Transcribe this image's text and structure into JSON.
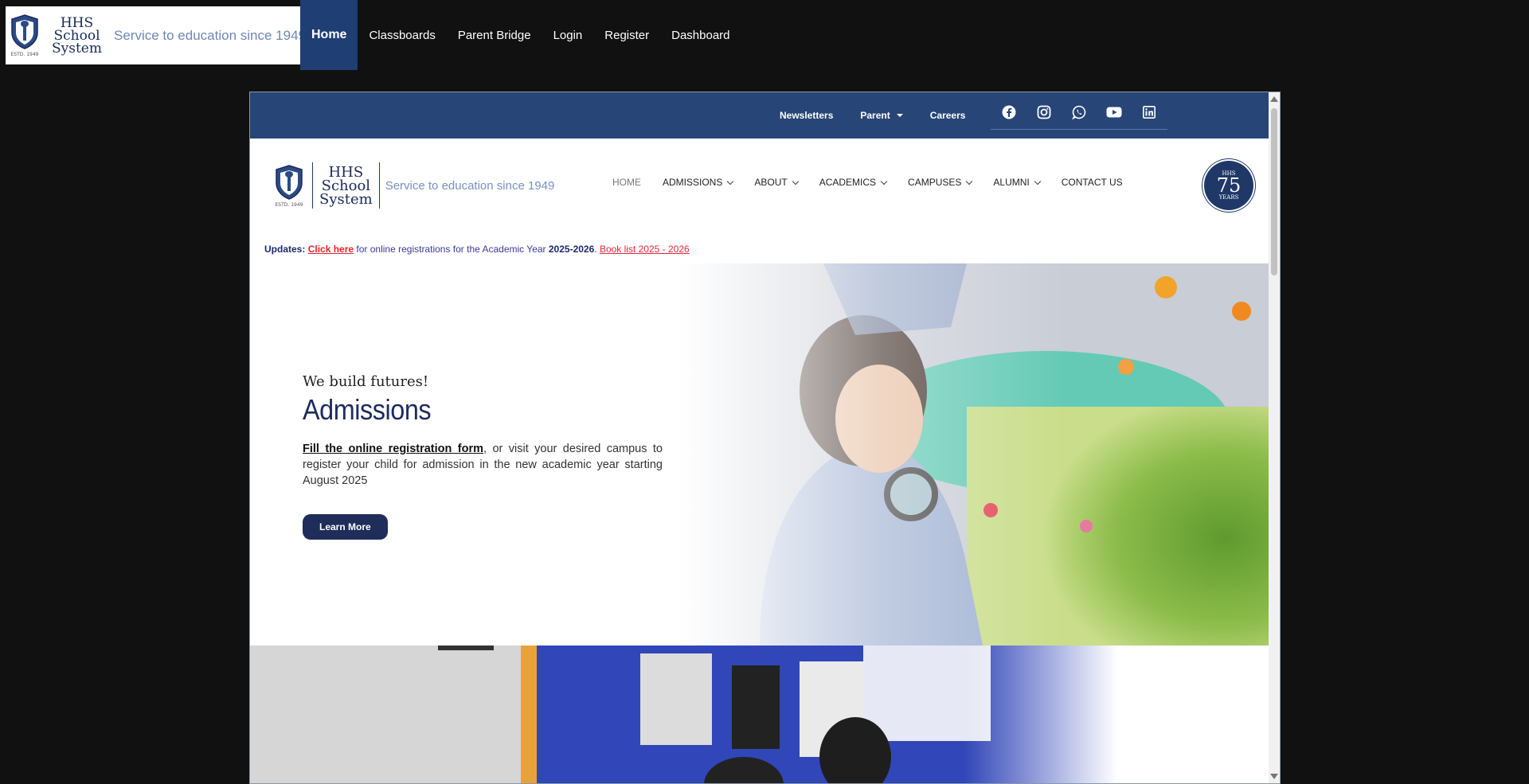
{
  "outer_nav": {
    "logo": {
      "name_lines": [
        "HHS",
        "School",
        "System"
      ],
      "tagline": "Service to education since 1949",
      "estd": "ESTD. 1949"
    },
    "items": [
      {
        "label": "Home",
        "active": true
      },
      {
        "label": "Classboards"
      },
      {
        "label": "Parent Bridge"
      },
      {
        "label": "Login"
      },
      {
        "label": "Register"
      },
      {
        "label": "Dashboard"
      }
    ]
  },
  "site": {
    "topbar": {
      "links": [
        "Newsletters",
        "Parent",
        "Careers"
      ],
      "social_icons": [
        "facebook-icon",
        "instagram-icon",
        "whatsapp-icon",
        "youtube-icon",
        "linkedin-icon"
      ]
    },
    "logo": {
      "name_lines": [
        "HHS",
        "School",
        "System"
      ],
      "tagline": "Service to education since 1949",
      "estd": "ESTD. 1949"
    },
    "main_nav": [
      "HOME",
      "ADMISSIONS",
      "ABOUT",
      "ACADEMICS",
      "CAMPUSES",
      "ALUMNI",
      "CONTACT US"
    ],
    "badge": {
      "top": "HHS",
      "number": "75",
      "bottom": "YEARS"
    },
    "updates": {
      "label": "Updates:",
      "click_here": "Click here",
      "text": " for online registrations for the Academic Year ",
      "year": "2025-2026",
      "dot": ". ",
      "book_list": "Book list 2025 - 2026"
    },
    "hero": {
      "subtitle": "We build futures!",
      "title": "Admissions",
      "form_link": "Fill the online registration form",
      "body": ", or visit your desired campus to register your child for admission in the new academic year starting August 2025",
      "button": "Learn More"
    }
  },
  "colors": {
    "outer_bg": "#111111",
    "nav_active": "#1f3e73",
    "topbar": "#274577",
    "navy_text": "#1d2b5e",
    "update_red": "#e0252a"
  }
}
